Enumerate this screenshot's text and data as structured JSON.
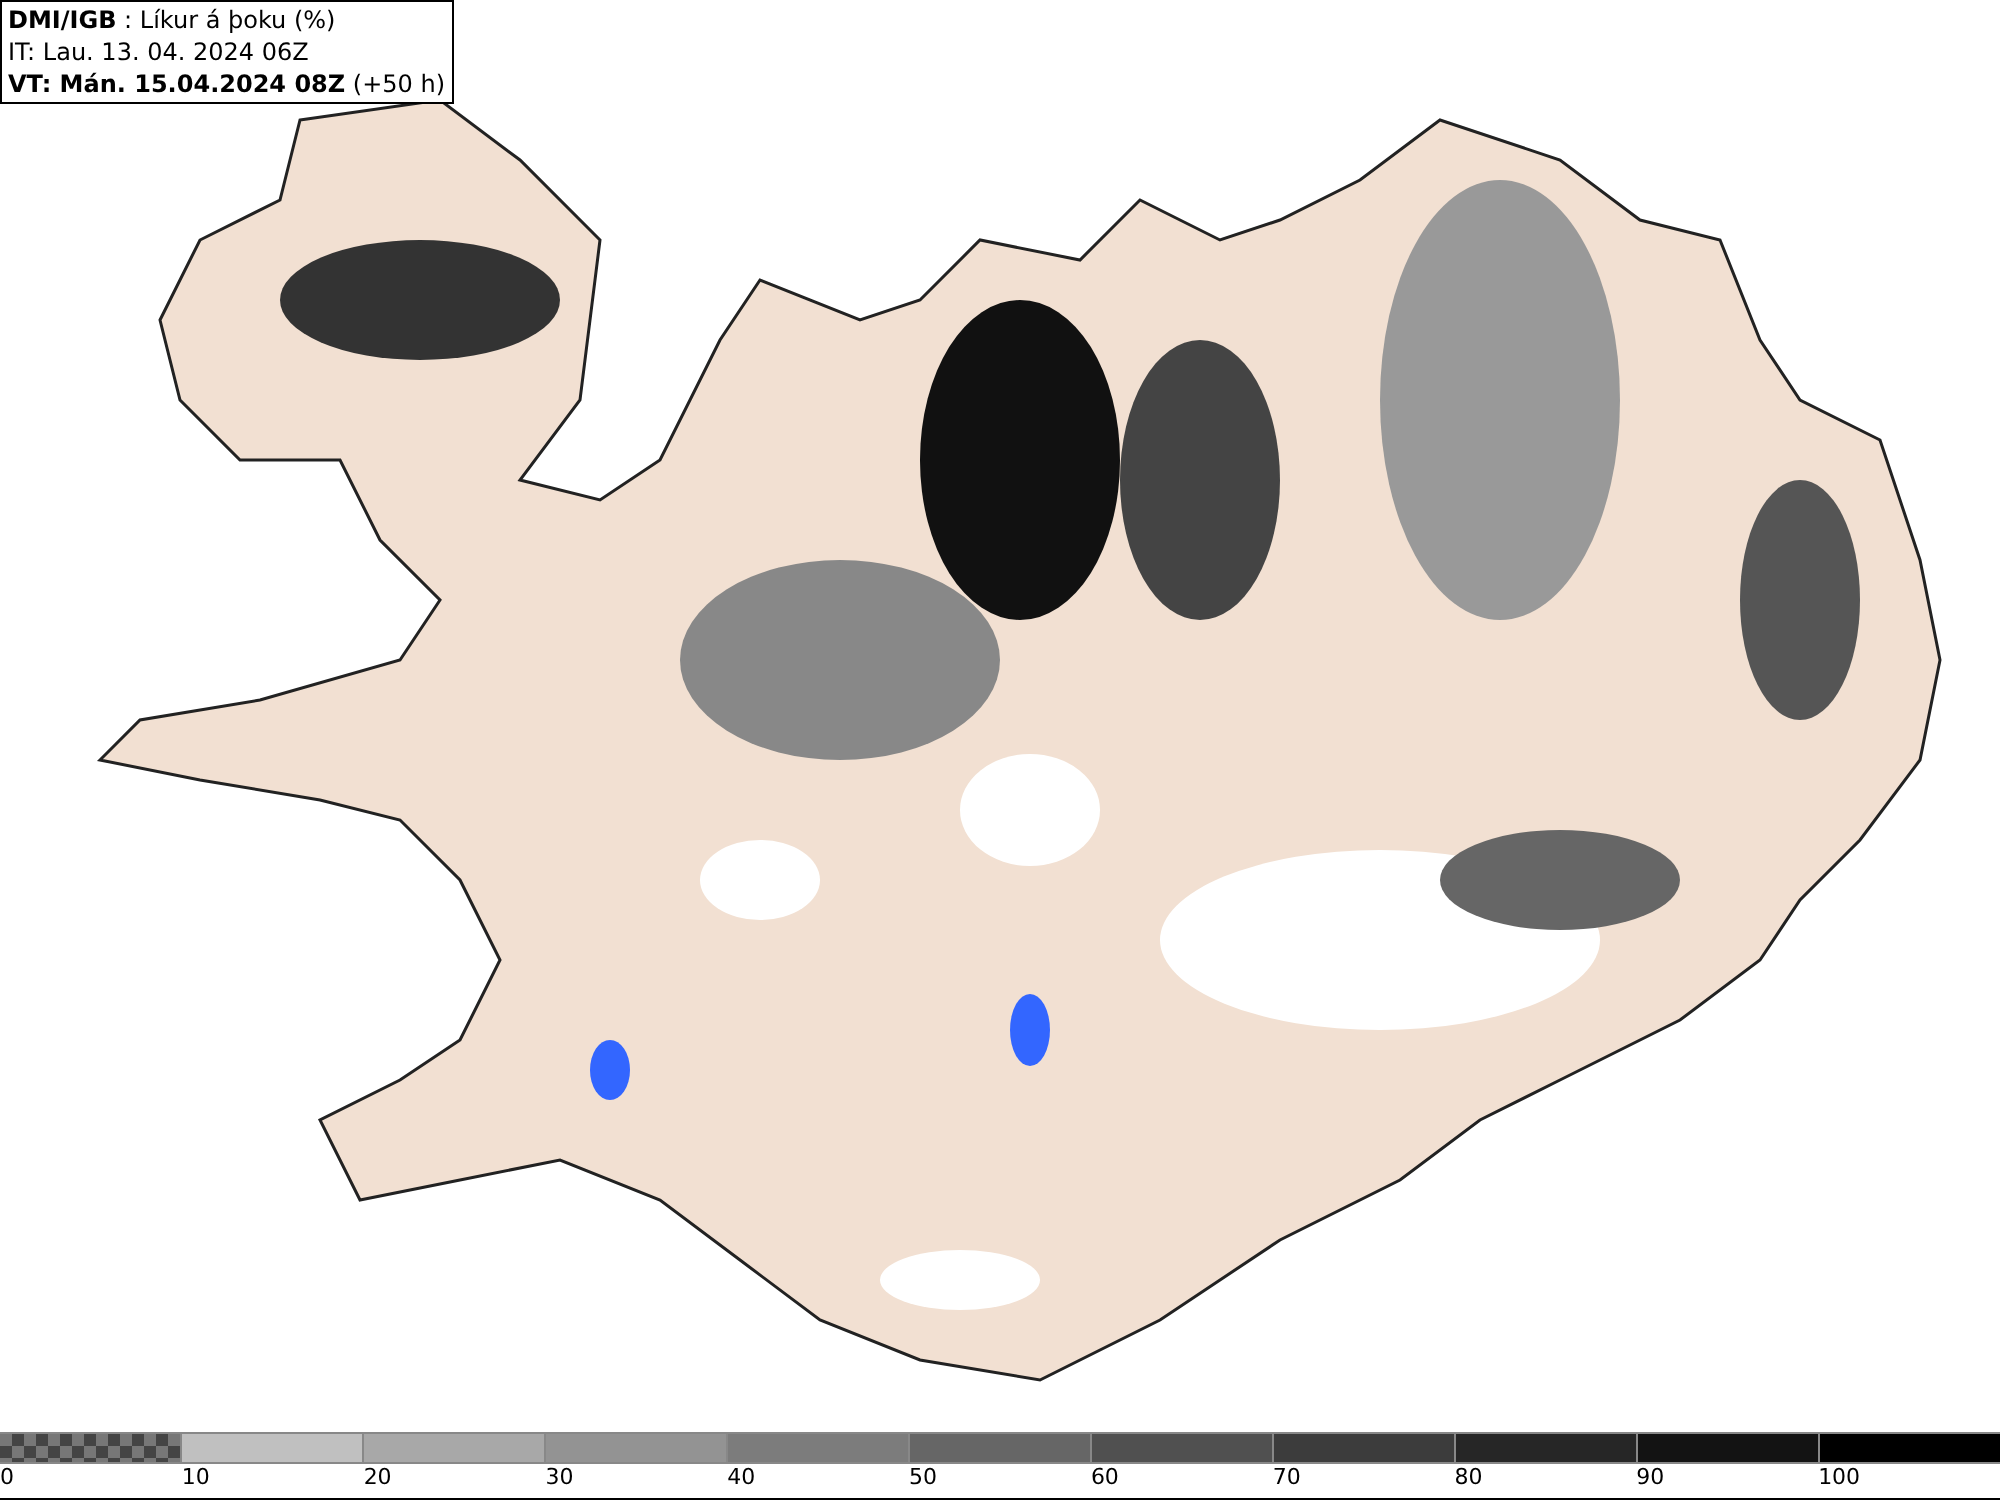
{
  "info_box": {
    "lines": [
      "**DMI/IGB** : Líkur á þoku (%)",
      "IT: Lau. 13. 04. 2024 06Z",
      "**VT: Mán. 15.04.2024 08Z** (+50 h)"
    ]
  },
  "legend": {
    "segments": [
      {
        "kind": "checker",
        "color": "#777777"
      },
      {
        "kind": "solid",
        "color": "#c0c0c0"
      },
      {
        "kind": "solid",
        "color": "#a8a8a8"
      },
      {
        "kind": "solid",
        "color": "#939393"
      },
      {
        "kind": "solid",
        "color": "#7c7c7c"
      },
      {
        "kind": "solid",
        "color": "#666666"
      },
      {
        "kind": "solid",
        "color": "#505050"
      },
      {
        "kind": "solid",
        "color": "#3c3c3c"
      },
      {
        "kind": "solid",
        "color": "#262626"
      },
      {
        "kind": "solid",
        "color": "#131313"
      },
      {
        "kind": "solid",
        "color": "#000000"
      }
    ],
    "labels": [
      "0",
      "10",
      "20",
      "30",
      "40",
      "50",
      "60",
      "70",
      "80",
      "90",
      "100"
    ]
  }
}
